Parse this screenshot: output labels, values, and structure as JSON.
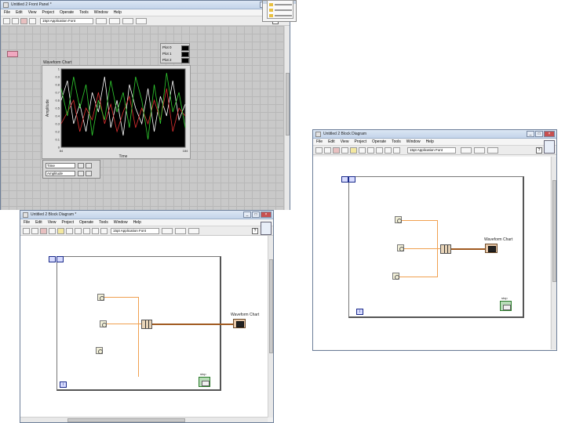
{
  "front_panel": {
    "title": "Untitled 2 Front Panel *",
    "menu": [
      "File",
      "Edit",
      "View",
      "Project",
      "Operate",
      "Tools",
      "Window",
      "Help"
    ],
    "font_dropdown": "15pt Application Font",
    "chart_title": "Waveform Chart",
    "plot_legend": [
      "Plot 0",
      "Plot 1",
      "Plot 2"
    ],
    "xlabel": "Time",
    "ylabel": "Amplitude",
    "y_ticks": [
      "1",
      "0.9",
      "0.8",
      "0.7",
      "0.6",
      "0.5",
      "0.4",
      "0.3",
      "0.2",
      "0.1",
      "0"
    ],
    "x_ticks": [
      "84",
      "",
      "",
      "",
      "",
      "",
      "",
      "",
      "",
      "",
      "184"
    ],
    "scale_legend": [
      "Time",
      "Amplitude"
    ],
    "stop_label": ""
  },
  "bd_left": {
    "title": "Untitled 2 Block Diagram *",
    "menu": [
      "File",
      "Edit",
      "View",
      "Project",
      "Operate",
      "Tools",
      "Window",
      "Help"
    ],
    "font_dropdown": "15pt Application Font",
    "chart_label": "Waveform Chart",
    "iter_label": "i",
    "stop_label": "stop"
  },
  "bd_right": {
    "title": "Untitled 2 Block Diagram",
    "menu": [
      "File",
      "Edit",
      "View",
      "Project",
      "Operate",
      "Tools",
      "Window",
      "Help"
    ],
    "font_dropdown": "15pt Application Font",
    "chart_label": "Waveform Chart",
    "iter_label": "i",
    "stop_label": "stop"
  },
  "colors": {
    "plot0": "#ffffff",
    "plot1": "#e03030",
    "plot2": "#30d030",
    "wire_numeric": "#f0a050",
    "wire_cluster": "#a05a20"
  },
  "chart_data": {
    "type": "line",
    "title": "Waveform Chart",
    "xlabel": "Time",
    "ylabel": "Amplitude",
    "xlim": [
      84,
      184
    ],
    "ylim": [
      0,
      1
    ],
    "grid": false,
    "legend": "top-right",
    "x": [
      84,
      89,
      94,
      99,
      104,
      109,
      114,
      119,
      124,
      129,
      134,
      139,
      144,
      149,
      154,
      159,
      164,
      169,
      174,
      179,
      184
    ],
    "series": [
      {
        "name": "Plot 0",
        "values": [
          0.6,
          0.85,
          0.3,
          0.55,
          0.2,
          0.7,
          0.45,
          0.9,
          0.25,
          0.6,
          0.15,
          0.8,
          0.5,
          0.3,
          0.75,
          0.2,
          0.65,
          0.4,
          0.85,
          0.35,
          0.55
        ]
      },
      {
        "name": "Plot 1",
        "values": [
          0.3,
          0.45,
          0.6,
          0.2,
          0.5,
          0.35,
          0.7,
          0.3,
          0.55,
          0.2,
          0.45,
          0.65,
          0.25,
          0.5,
          0.3,
          0.6,
          0.35,
          0.75,
          0.2,
          0.5,
          0.4
        ]
      },
      {
        "name": "Plot 2",
        "values": [
          0.75,
          0.4,
          0.9,
          0.5,
          0.8,
          0.15,
          0.6,
          0.35,
          0.85,
          0.45,
          0.7,
          0.25,
          0.9,
          0.6,
          0.1,
          0.8,
          0.3,
          0.95,
          0.45,
          0.7,
          0.25
        ]
      }
    ]
  }
}
